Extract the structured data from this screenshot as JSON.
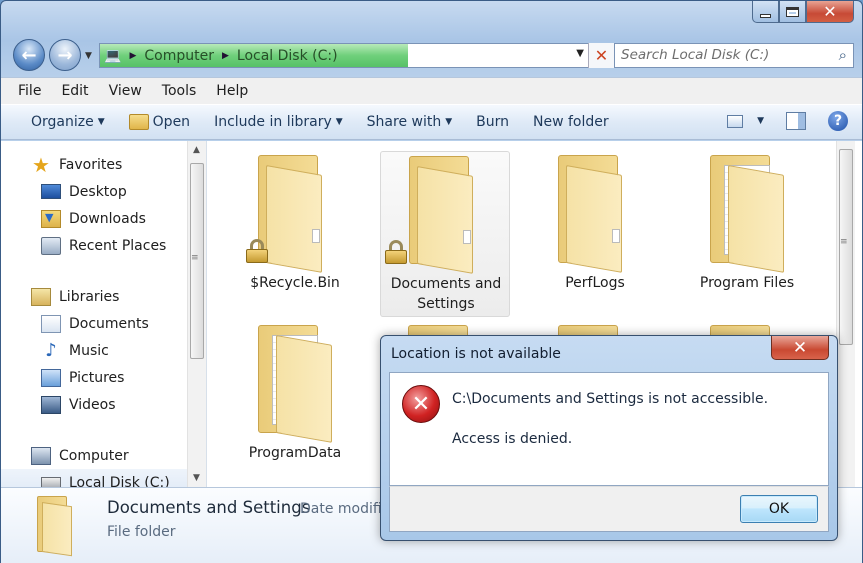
{
  "window": {
    "accent": "#6e9ccc"
  },
  "caption": {
    "min_icon": "minimize-icon",
    "max_icon": "maximize-icon",
    "close_icon": "close-icon"
  },
  "navigation": {
    "address_path": [
      "Computer",
      "Local Disk (C:)"
    ],
    "address_progress": 0.6,
    "search_placeholder": "Search Local Disk (C:)"
  },
  "menubar": {
    "items": [
      "File",
      "Edit",
      "View",
      "Tools",
      "Help"
    ]
  },
  "commandbar": {
    "organize": "Organize",
    "open": "Open",
    "include_in_library": "Include in library",
    "share_with": "Share with",
    "burn": "Burn",
    "new_folder": "New folder"
  },
  "navpane": {
    "favorites": "Favorites",
    "desktop": "Desktop",
    "downloads": "Downloads",
    "recent_places": "Recent Places",
    "libraries": "Libraries",
    "documents": "Documents",
    "music": "Music",
    "pictures": "Pictures",
    "videos": "Videos",
    "computer": "Computer",
    "local_disk": "Local Disk (C:)"
  },
  "files": [
    {
      "name": "$Recycle.Bin",
      "locked": true
    },
    {
      "name": "Documents and Settings",
      "locked": true,
      "selected": true
    },
    {
      "name": "PerfLogs",
      "locked": false
    },
    {
      "name": "Program Files",
      "locked": false
    },
    {
      "name": "ProgramData",
      "locked": false
    }
  ],
  "details": {
    "name": "Documents and Settings",
    "date_label": "Date modifi",
    "type": "File folder"
  },
  "dialog": {
    "title": "Location is not available",
    "message": "C:\\Documents and Settings is not accessible.",
    "detail": "Access is denied.",
    "ok_label": "OK",
    "close_icon": "close-icon",
    "error_icon": "error-icon"
  }
}
